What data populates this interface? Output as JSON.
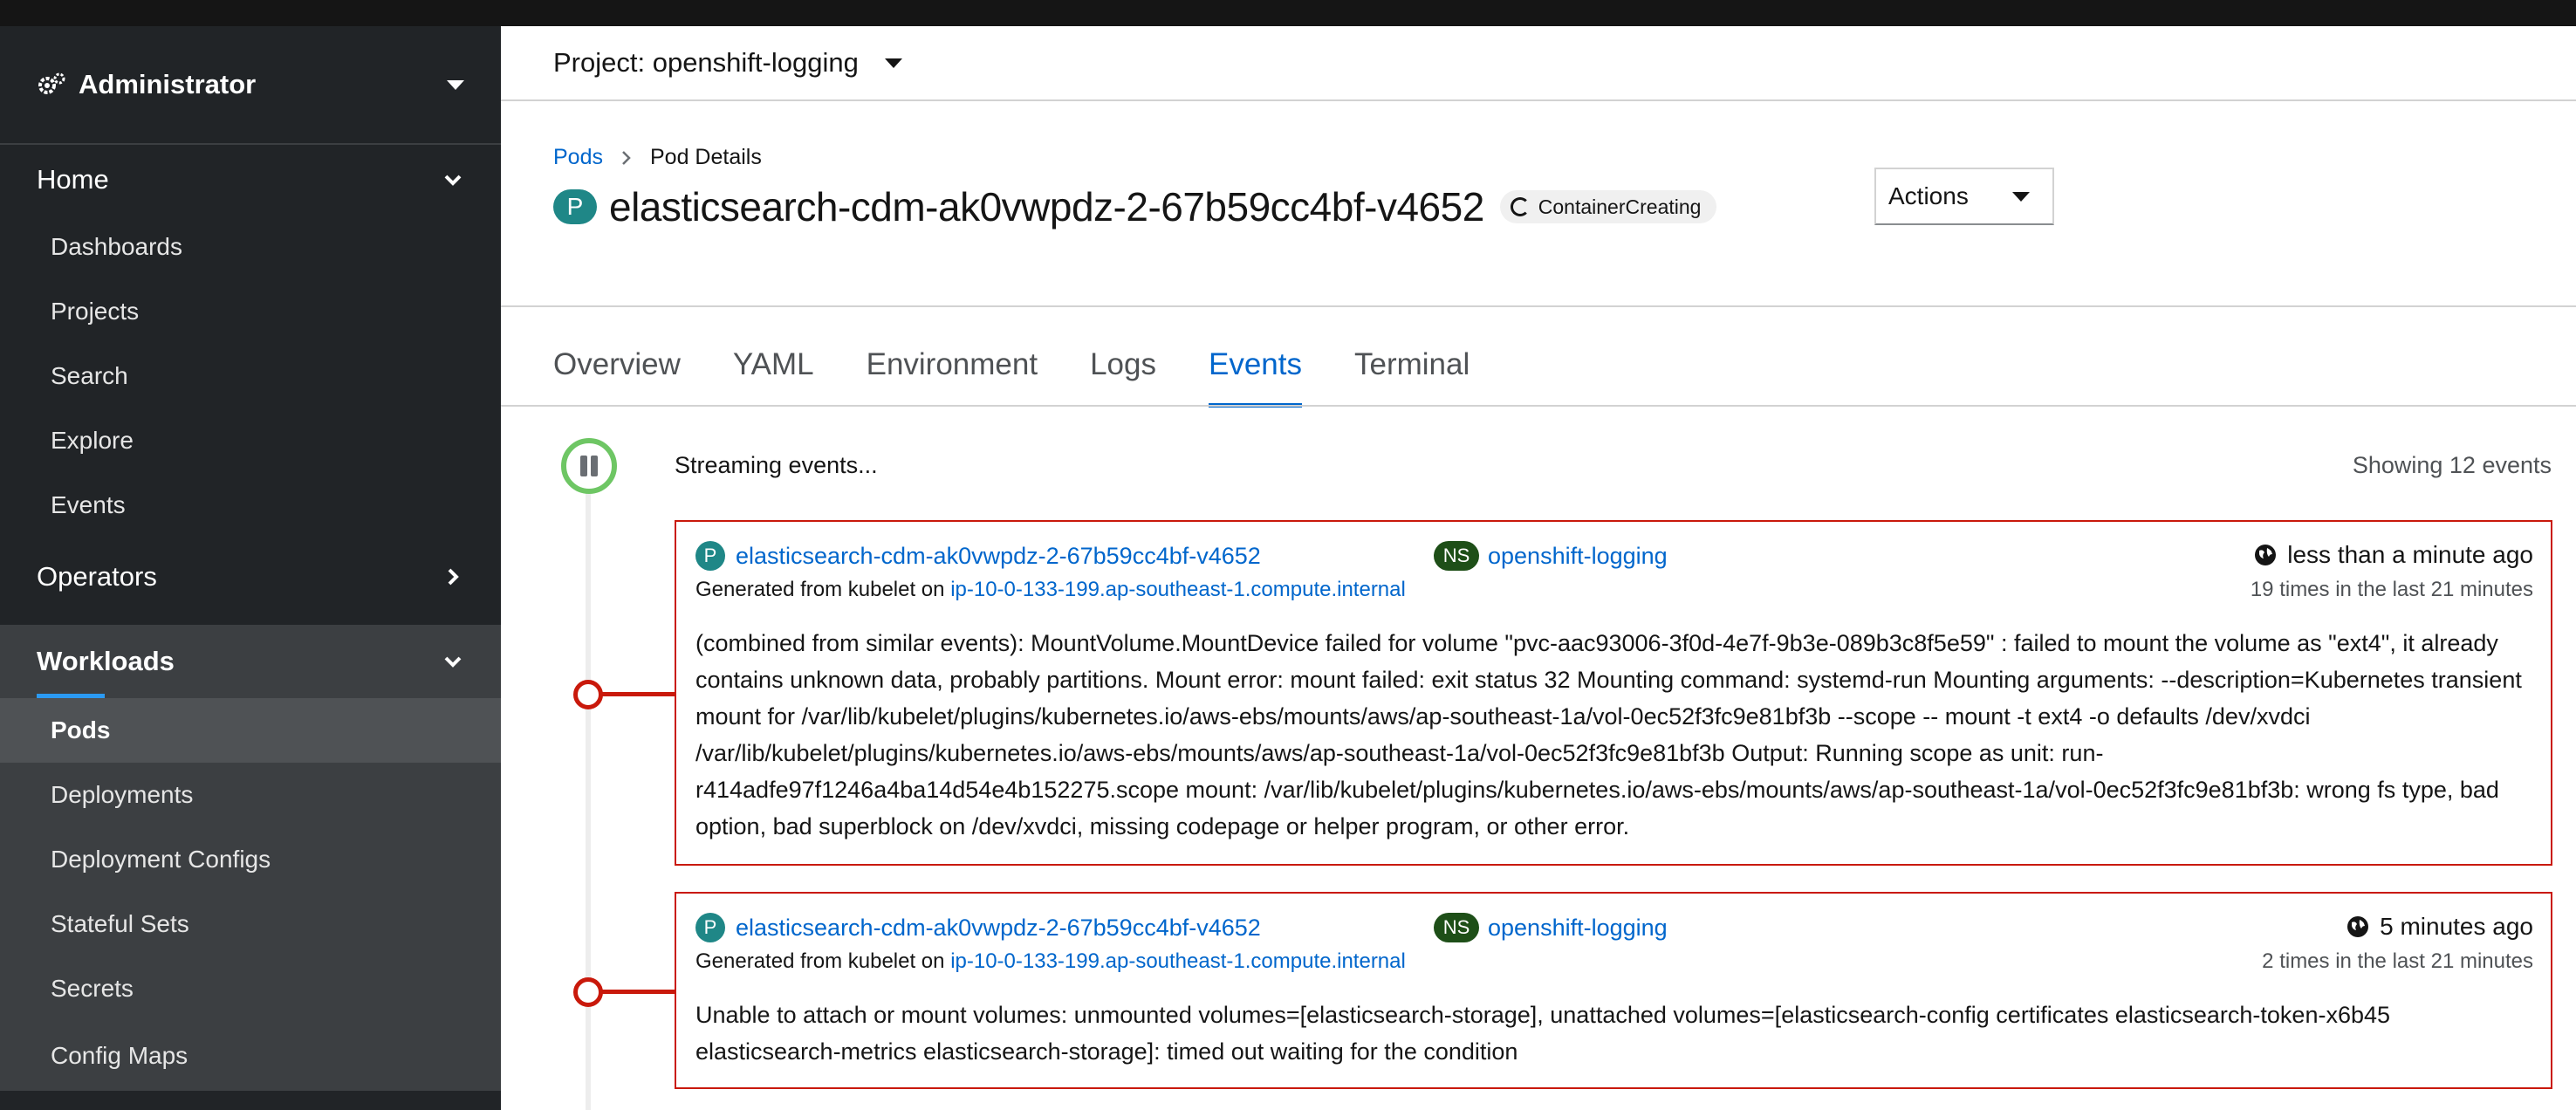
{
  "sidebar": {
    "perspective": "Administrator",
    "sections": {
      "home": "Home",
      "operators": "Operators",
      "workloads": "Workloads"
    },
    "home_items": [
      "Dashboards",
      "Projects",
      "Search",
      "Explore",
      "Events"
    ],
    "workloads_items": [
      "Pods",
      "Deployments",
      "Deployment Configs",
      "Stateful Sets",
      "Secrets",
      "Config Maps"
    ]
  },
  "project": {
    "label": "Project: openshift-logging"
  },
  "breadcrumb": {
    "parent": "Pods",
    "current": "Pod Details"
  },
  "pod": {
    "badge": "P",
    "name": "elasticsearch-cdm-ak0vwpdz-2-67b59cc4bf-v4652",
    "status": "ContainerCreating"
  },
  "actions_label": "Actions",
  "tabs": [
    "Overview",
    "YAML",
    "Environment",
    "Logs",
    "Events",
    "Terminal"
  ],
  "active_tab": "Events",
  "events_panel": {
    "streaming": "Streaming events...",
    "showing": "Showing 12 events"
  },
  "events": [
    {
      "badge": "P",
      "resource": "elasticsearch-cdm-ak0vwpdz-2-67b59cc4bf-v4652",
      "ns_badge": "NS",
      "namespace": "openshift-logging",
      "time": "less than a minute ago",
      "generated_prefix": "Generated from kubelet on",
      "node": "ip-10-0-133-199.ap-southeast-1.compute.internal",
      "count": "19 times in the last 21 minutes",
      "message": "(combined from similar events): MountVolume.MountDevice failed for volume \"pvc-aac93006-3f0d-4e7f-9b3e-089b3c8f5e59\" : failed to mount the volume as \"ext4\", it already contains unknown data, probably partitions. Mount error: mount failed: exit status 32 Mounting command: systemd-run Mounting arguments: --description=Kubernetes transient mount for /var/lib/kubelet/plugins/kubernetes.io/aws-ebs/mounts/aws/ap-southeast-1a/vol-0ec52f3fc9e81bf3b --scope -- mount -t ext4 -o defaults /dev/xvdci /var/lib/kubelet/plugins/kubernetes.io/aws-ebs/mounts/aws/ap-southeast-1a/vol-0ec52f3fc9e81bf3b Output: Running scope as unit: run-r414adfe97f1246a4ba14d54e4b152275.scope mount: /var/lib/kubelet/plugins/kubernetes.io/aws-ebs/mounts/aws/ap-southeast-1a/vol-0ec52f3fc9e81bf3b: wrong fs type, bad option, bad superblock on /dev/xvdci, missing codepage or helper program, or other error."
    },
    {
      "badge": "P",
      "resource": "elasticsearch-cdm-ak0vwpdz-2-67b59cc4bf-v4652",
      "ns_badge": "NS",
      "namespace": "openshift-logging",
      "time": "5 minutes ago",
      "generated_prefix": "Generated from kubelet on",
      "node": "ip-10-0-133-199.ap-southeast-1.compute.internal",
      "count": "2 times in the last 21 minutes",
      "message": "Unable to attach or mount volumes: unmounted volumes=[elasticsearch-storage], unattached volumes=[elasticsearch-config certificates elasticsearch-token-x6b45 elasticsearch-metrics elasticsearch-storage]: timed out waiting for the condition"
    }
  ],
  "colors": {
    "sidebar_bg": "#212427",
    "link": "#0066cc",
    "warning_border": "#c9190b",
    "streaming_ring": "#6ec664",
    "pod_badge": "#1f8787",
    "ns_badge": "#1e4f18"
  },
  "icons": {
    "perspective": "gears-icon",
    "pause": "pause-icon",
    "time": "globe-icon"
  }
}
